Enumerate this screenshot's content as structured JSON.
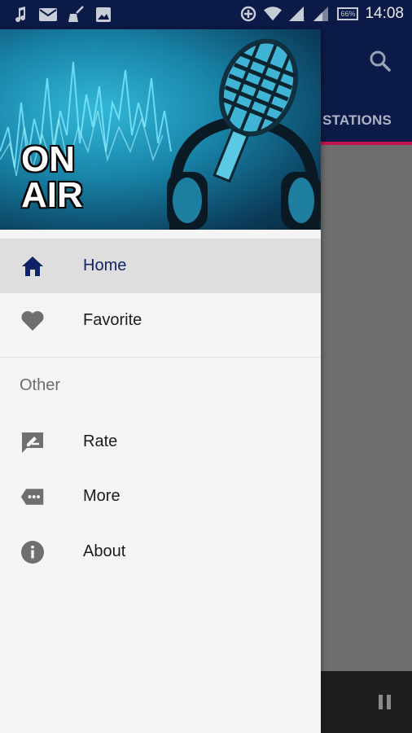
{
  "status_bar": {
    "time": "14:08",
    "battery": "66%",
    "icons": [
      "music-note-icon",
      "mail-icon",
      "broom-icon",
      "image-icon",
      "data-saver-icon",
      "wifi-icon",
      "signal-icon",
      "signal-x-icon",
      "signal-2-icon",
      "battery-icon"
    ]
  },
  "app": {
    "tab_partial": "STATIONS",
    "search_icon": "search-icon",
    "pause_icon": "pause-icon"
  },
  "drawer": {
    "header": {
      "line1": "ON",
      "line2": "AIR"
    },
    "items": [
      {
        "label": "Home",
        "icon": "home-icon",
        "active": true
      },
      {
        "label": "Favorite",
        "icon": "heart-icon",
        "active": false
      }
    ],
    "section_title": "Other",
    "other_items": [
      {
        "label": "Rate",
        "icon": "rate-icon"
      },
      {
        "label": "More",
        "icon": "more-tag-icon"
      },
      {
        "label": "About",
        "icon": "info-icon"
      }
    ],
    "colors": {
      "accent": "#0c1a47",
      "active_bg": "#dedede",
      "active_text": "#10246a",
      "tab_indicator": "#c0144a"
    }
  }
}
